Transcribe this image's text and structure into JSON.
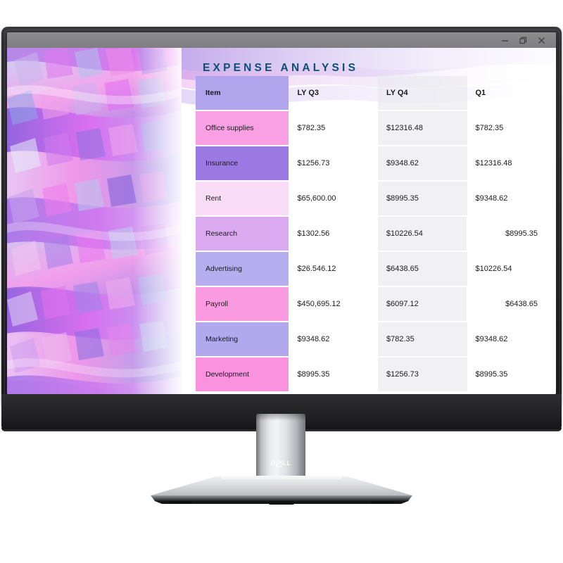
{
  "device": {
    "brand": "DELL",
    "type": "monitor"
  },
  "window": {
    "controls": [
      {
        "name": "minimize",
        "glyph": "minimize-icon"
      },
      {
        "name": "restore",
        "glyph": "restore-icon"
      },
      {
        "name": "close",
        "glyph": "close-icon"
      }
    ]
  },
  "slide": {
    "title": "EXPENSE ANALYSIS",
    "title_color": "#0e4f73"
  },
  "table": {
    "headers": [
      "Item",
      "LY Q3",
      "LY Q4",
      "Q1"
    ],
    "header_chip_color": "#b0a4ec",
    "rows": [
      {
        "item": "Office supplies",
        "ly_q3": "$782.35",
        "ly_q4": "$12316.48",
        "q1": "$782.35",
        "chip": "#f9a0e4"
      },
      {
        "item": "Insurance",
        "ly_q3": "$1256.73",
        "ly_q4": "$9348.62",
        "q1": "$12316.48",
        "chip": "#9a79e2"
      },
      {
        "item": "Rent",
        "ly_q3": "$65,600.00",
        "ly_q4": "$8995.35",
        "q1": "$9348.62",
        "chip": "#fbdcf6"
      },
      {
        "item": "Research",
        "ly_q3": "$1302.56",
        "ly_q4": "$10226.54",
        "q1": "$8995.35",
        "chip": "#dcaaf0"
      },
      {
        "item": "Advertising",
        "ly_q3": "$26.546.12",
        "ly_q4": "$6438.65",
        "q1": "$10226.54",
        "chip": "#b6aeee"
      },
      {
        "item": "Payroll",
        "ly_q3": "$450,695.12",
        "ly_q4": "$6097.12",
        "q1": "$6438.65",
        "chip": "#fb9ce2"
      },
      {
        "item": "Marketing",
        "ly_q3": "$9348.62",
        "ly_q4": "$782.35",
        "q1": "$9348.62",
        "chip": "#b2a8ee"
      },
      {
        "item": "Development",
        "ly_q3": "$8995.35",
        "ly_q4": "$1256.73",
        "q1": "$8995.35",
        "chip": "#fa92e0"
      }
    ],
    "q1_right_aligned_rows": [
      3,
      5
    ]
  },
  "artwork": {
    "name": "abstract-3d-waves",
    "palette": [
      "#a87ae8",
      "#e26ff0",
      "#f59ae8",
      "#8fa8e8",
      "#c9d6f2",
      "#7d5fd8",
      "#dcc4f2",
      "#b98ae8"
    ]
  }
}
